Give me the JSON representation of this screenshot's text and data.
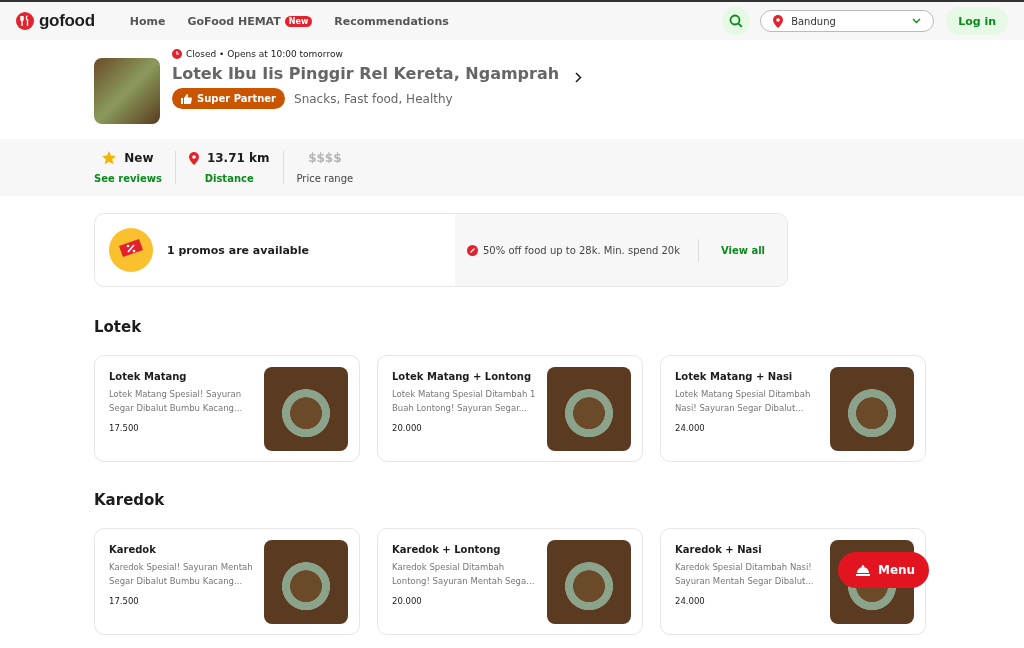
{
  "nav": {
    "logo": "gofood",
    "links": [
      {
        "label": "Home"
      },
      {
        "label": "GoFood HEMAT",
        "badge": "New"
      },
      {
        "label": "Recommendations"
      }
    ],
    "location": "Bandung",
    "login": "Log in"
  },
  "restaurant": {
    "status": "Closed • Opens at 10:00 tomorrow",
    "name": "Lotek Ibu Iis Pinggir Rel Kereta, Ngamprah",
    "badge": "Super Partner",
    "cuisines": "Snacks, Fast food, Healthy"
  },
  "stats": [
    {
      "kind": "rating",
      "value": "New",
      "label": "See reviews"
    },
    {
      "kind": "distance",
      "value": "13.71 km",
      "label": "Distance"
    },
    {
      "kind": "price",
      "value": "$$$$",
      "label": "Price range"
    }
  ],
  "promo": {
    "title": "1 promos are available",
    "offer": "50% off food up to 28k. Min. spend 20k",
    "link": "View all"
  },
  "sections": [
    {
      "title": "Lotek",
      "items": [
        {
          "name": "Lotek Matang",
          "description": "Lotek Matang Spesial! Sayuran Segar Dibalut Bumbu Kacang...",
          "price": "17.500"
        },
        {
          "name": "Lotek Matang + Lontong",
          "description": "Lotek Matang Spesial Ditambah 1 Buah Lontong! Sayuran Segar...",
          "price": "20.000"
        },
        {
          "name": "Lotek Matang + Nasi",
          "description": "Lotek Matang Spesial Ditambah Nasi! Sayuran Segar Dibalut...",
          "price": "24.000"
        }
      ]
    },
    {
      "title": "Karedok",
      "items": [
        {
          "name": "Karedok",
          "description": "Karedok Spesial! Sayuran Mentah Segar Dibalut Bumbu Kacang...",
          "price": "17.500"
        },
        {
          "name": "Karedok + Lontong",
          "description": "Karedok Spesial Ditambah Lontong! Sayuran Mentah Sega...",
          "price": "20.000"
        },
        {
          "name": "Karedok + Nasi",
          "description": "Karedok Spesial Ditambah Nasi! Sayuran Mentah Segar Dibalut...",
          "price": "24.000"
        }
      ]
    }
  ],
  "menu_button": "Menu"
}
